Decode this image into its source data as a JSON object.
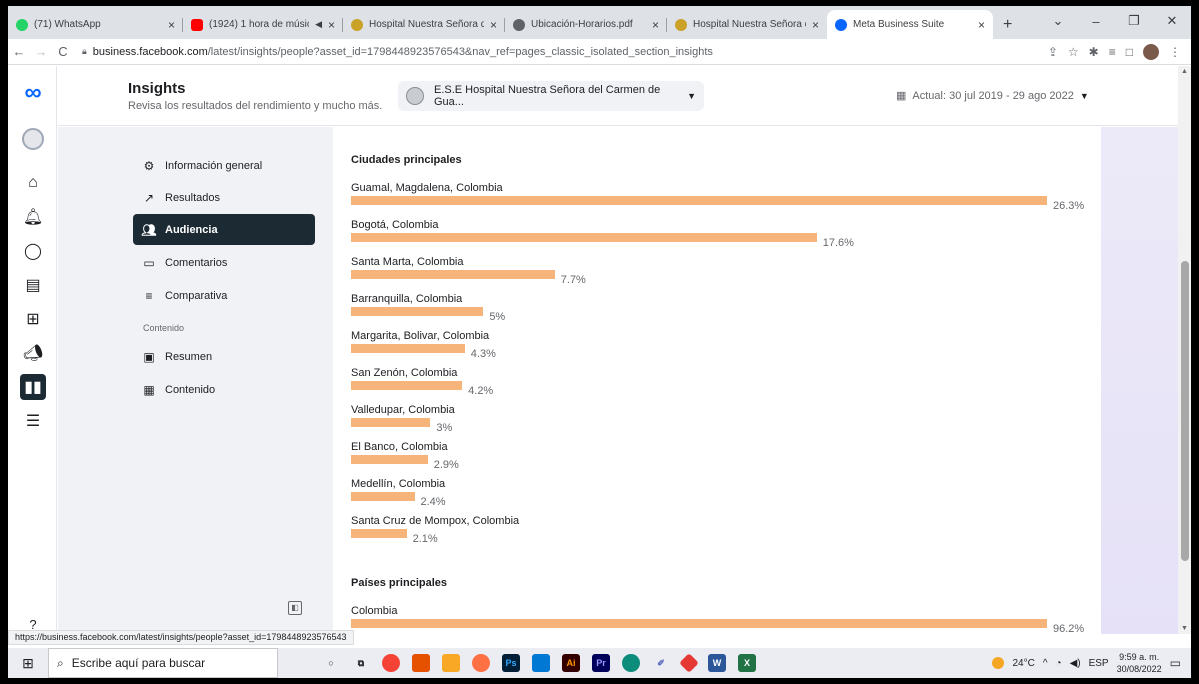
{
  "browser": {
    "tabs": [
      {
        "label": "(71) WhatsApp",
        "icon": "whatsapp-icon",
        "color": "#25d366"
      },
      {
        "label": "(1924) 1 hora de músic",
        "icon": "youtube-icon",
        "color": "#ff0000",
        "extra": "◀×"
      },
      {
        "label": "Hospital Nuestra Señora de",
        "icon": "hospital-icon",
        "color": "#c9a227"
      },
      {
        "label": "Ubicación-Horarios.pdf",
        "icon": "globe-icon",
        "color": "#5f6368"
      },
      {
        "label": "Hospital Nuestra Señora de",
        "icon": "hospital-icon",
        "color": "#c9a227"
      },
      {
        "label": "Meta Business Suite",
        "icon": "meta-icon",
        "color": "#0866ff"
      }
    ],
    "url_host": "business.facebook.com",
    "url_path": "/latest/insights/people?asset_id=1798448923576543&nav_ref=pages_classic_isolated_section_insights",
    "status_url": "https://business.facebook.com/latest/insights/people?asset_id=1798448923576543"
  },
  "header": {
    "title": "Insights",
    "subtitle": "Revisa los resultados del rendimiento y mucho más.",
    "account": "E.S.E Hospital Nuestra Señora del Carmen de Gua...",
    "date_range": "Actual: 30 jul 2019 - 29 ago 2022"
  },
  "nav": {
    "items": [
      {
        "label": "Información general",
        "icon": "overview-icon"
      },
      {
        "label": "Resultados",
        "icon": "trend-icon"
      },
      {
        "label": "Audiencia",
        "icon": "audience-icon",
        "active": true
      },
      {
        "label": "Comentarios",
        "icon": "comment-icon"
      },
      {
        "label": "Comparativa",
        "icon": "compare-icon"
      }
    ],
    "section": "Contenido",
    "content_items": [
      {
        "label": "Resumen",
        "icon": "summary-icon"
      },
      {
        "label": "Contenido",
        "icon": "table-icon"
      }
    ]
  },
  "content": {
    "cities_title": "Ciudades principales",
    "countries_title": "Países principales",
    "accent_color": "#f7b47a"
  },
  "chart_data": [
    {
      "type": "bar",
      "title": "Ciudades principales",
      "categories": [
        "Guamal, Magdalena, Colombia",
        "Bogotá, Colombia",
        "Santa Marta, Colombia",
        "Barranquilla, Colombia",
        "Margarita, Bolivar, Colombia",
        "San Zenón, Colombia",
        "Valledupar, Colombia",
        "El Banco, Colombia",
        "Medellín, Colombia",
        "Santa Cruz de Mompox, Colombia"
      ],
      "values": [
        26.3,
        17.6,
        7.7,
        5,
        4.3,
        4.2,
        3,
        2.9,
        2.4,
        2.1
      ],
      "labels": [
        "26.3%",
        "17.6%",
        "7.7%",
        "5%",
        "4.3%",
        "4.2%",
        "3%",
        "2.9%",
        "2.4%",
        "2.1%"
      ]
    },
    {
      "type": "bar",
      "title": "Países principales",
      "categories": [
        "Colombia"
      ],
      "values": [
        96.2
      ],
      "labels": [
        "96.2%"
      ]
    }
  ],
  "taskbar": {
    "search_placeholder": "Escribe aquí para buscar",
    "temperature": "24°C",
    "language": "ESP",
    "time": "9:59 a. m.",
    "date": "30/08/2022"
  }
}
